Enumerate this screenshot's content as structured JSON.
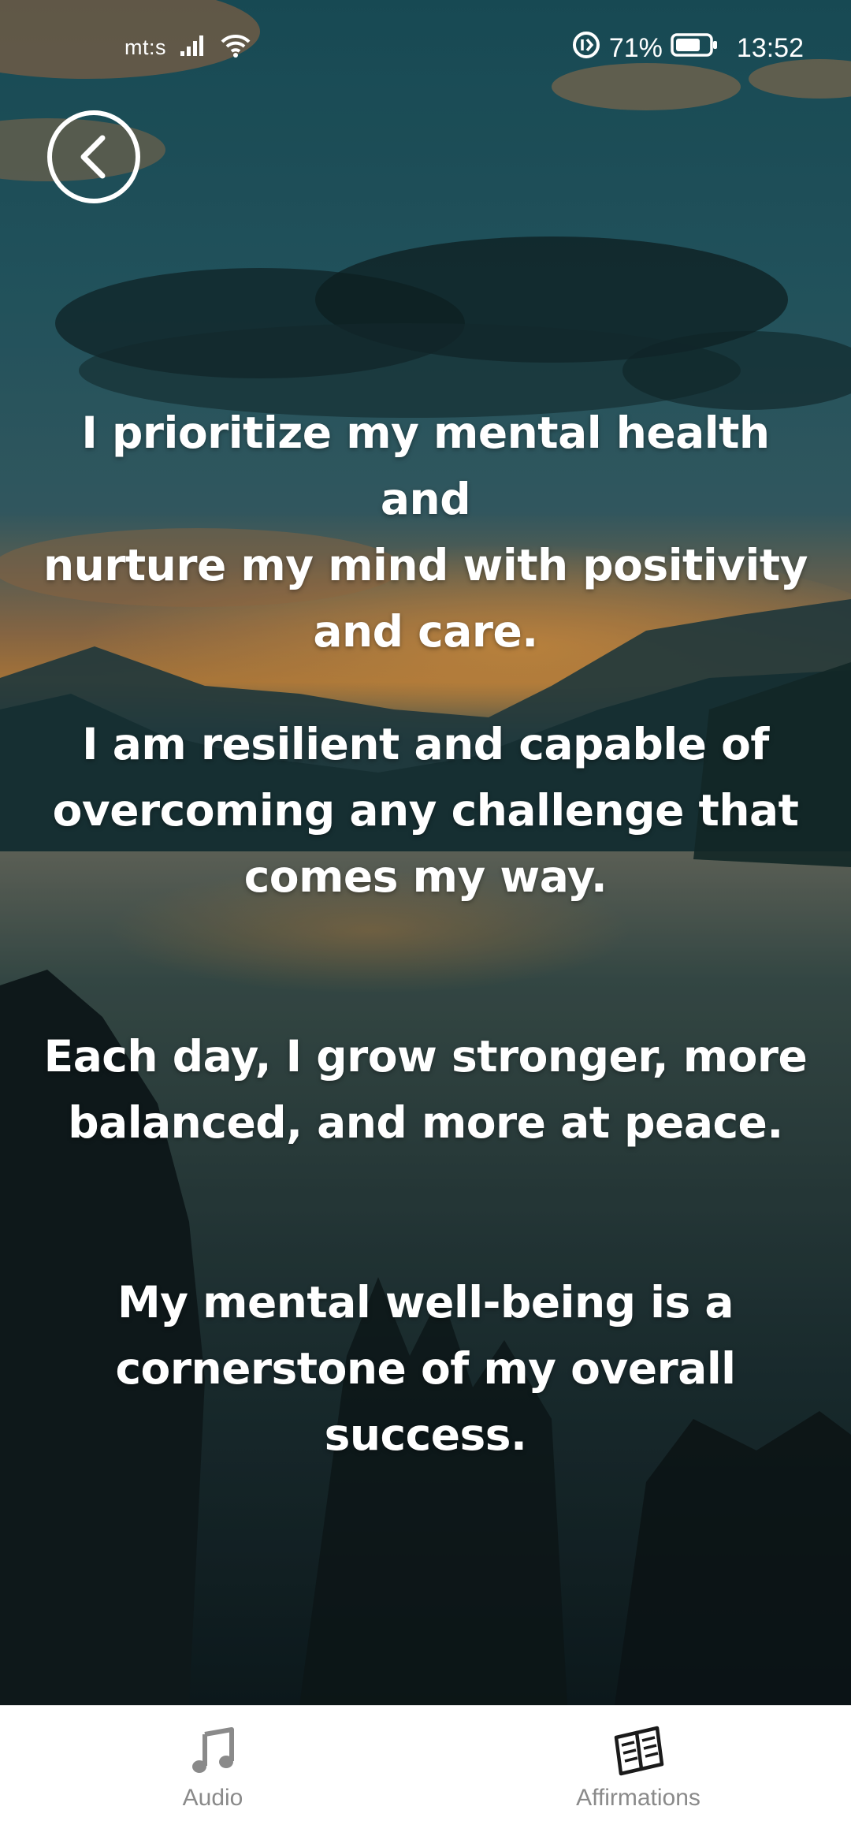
{
  "status_bar": {
    "carrier": "mt:s",
    "battery_percent": "71%",
    "time": "13:52"
  },
  "header": {
    "back_icon": "chevron-left-icon"
  },
  "affirmations": [
    {
      "line1": "I prioritize my mental health and",
      "line2": "nurture my mind with positivity",
      "line3": "and care."
    },
    {
      "line1": "I am resilient and capable of",
      "line2": "overcoming any challenge that",
      "line3": "comes my way."
    },
    {
      "line1": "Each day, I grow stronger, more",
      "line2": "balanced, and more at peace.",
      "line3": ""
    },
    {
      "line1": "My mental well-being is a",
      "line2": "cornerstone of my overall success.",
      "line3": ""
    }
  ],
  "tab_bar": {
    "tabs": [
      {
        "label": "Audio",
        "icon": "music-note-icon"
      },
      {
        "label": "Affirmations",
        "icon": "open-book-icon"
      }
    ],
    "active_tab": "Affirmations"
  },
  "colors": {
    "text": "#ffffff",
    "tab_inactive": "#8a8a8a",
    "tab_active_icon": "#1a1a1a",
    "tab_bar_bg": "#ffffff"
  }
}
